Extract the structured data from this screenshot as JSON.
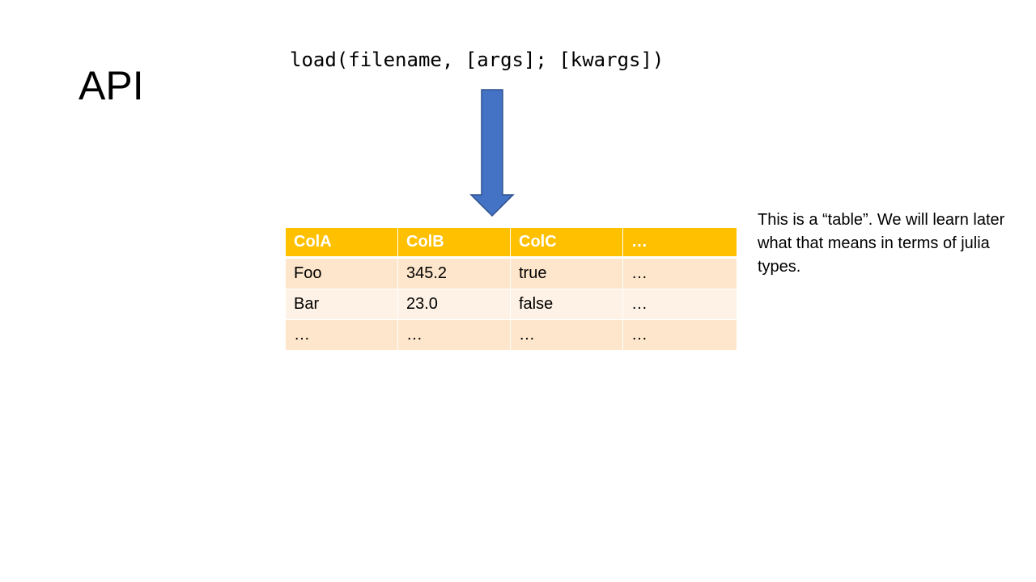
{
  "slide": {
    "title": "API",
    "code": "load(filename, [args]; [kwargs])",
    "arrow_color": "#4472c4",
    "table": {
      "header_color": "#ffc000",
      "columns": [
        "ColA",
        "ColB",
        "ColC",
        "…"
      ],
      "rows": [
        [
          "Foo",
          "345.2",
          "true",
          "…"
        ],
        [
          "Bar",
          "23.0",
          "false",
          "…"
        ],
        [
          "…",
          "…",
          "…",
          "…"
        ]
      ]
    },
    "note": "This is a “table”. We will learn later what that means in terms of julia types."
  }
}
